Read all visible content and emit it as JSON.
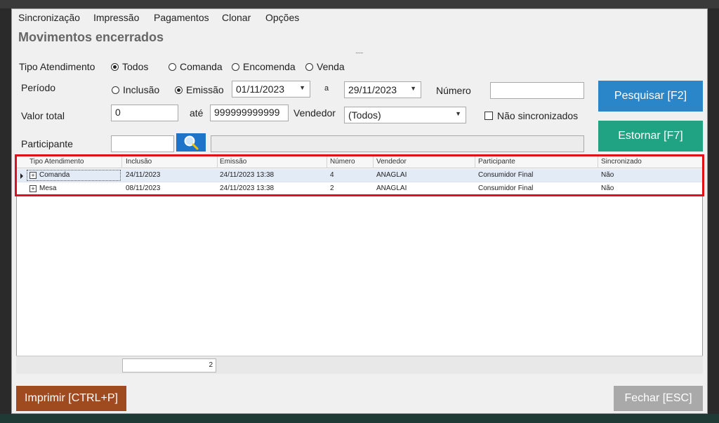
{
  "menu": [
    "Sincronização",
    "Impressão",
    "Pagamentos",
    "Clonar",
    "Opções"
  ],
  "title": "Movimentos encerrados",
  "tipo_atendimento": {
    "label": "Tipo Atendimento",
    "options": [
      "Todos",
      "Comanda",
      "Encomenda",
      "Venda"
    ],
    "selected": "Todos"
  },
  "periodo": {
    "label": "Período",
    "options": [
      "Inclusão",
      "Emissão"
    ],
    "selected": "Emissão",
    "from": "01/11/2023",
    "to_label": "a",
    "to": "29/11/2023"
  },
  "numero": {
    "label": "Número",
    "value": ""
  },
  "valor_total": {
    "label": "Valor total",
    "from": "0",
    "ate_label": "até",
    "to": "999999999999"
  },
  "vendedor": {
    "label": "Vendedor",
    "value": "(Todos)"
  },
  "nao_sincronizados": {
    "label": "Não sincronizados",
    "checked": false
  },
  "participante": {
    "label": "Participante",
    "code": "",
    "name": ""
  },
  "buttons": {
    "pesquisar": "Pesquisar [F2]",
    "estornar": "Estornar [F7]",
    "imprimir": "Imprimir [CTRL+P]",
    "fechar": "Fechar [ESC]"
  },
  "grid": {
    "columns": [
      "Tipo Atendimento",
      "Inclusão",
      "Emissão",
      "Número",
      "Vendedor",
      "Participante",
      "Sincronizado"
    ],
    "rows": [
      [
        "Comanda",
        "24/11/2023",
        "24/11/2023 13:38",
        "4",
        "ANAGLAI",
        "Consumidor Final",
        "Não"
      ],
      [
        "Mesa",
        "08/11/2023",
        "24/11/2023 13:38",
        "2",
        "ANAGLAI",
        "Consumidor Final",
        "Não"
      ]
    ],
    "footer_count": "2"
  },
  "colors": {
    "pesquisar": "#2b85c9",
    "estornar": "#1fa382",
    "imprimir": "#a04a1f",
    "fechar": "#a9a9a9",
    "highlight": "#e0101a"
  }
}
